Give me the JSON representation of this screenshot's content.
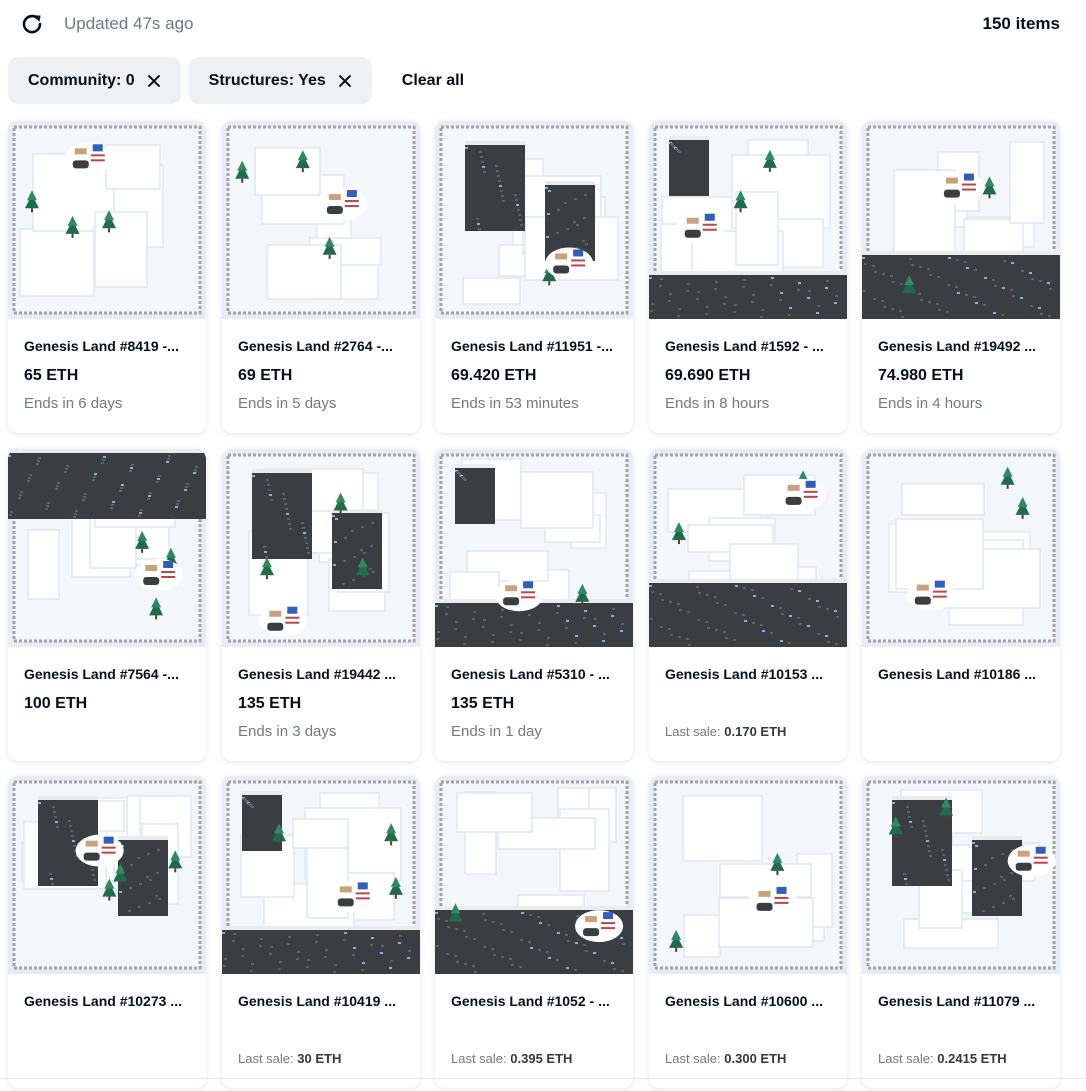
{
  "header": {
    "updated": "Updated 47s ago",
    "item_count": "150 items"
  },
  "filters": {
    "chips": [
      {
        "label": "Community: 0"
      },
      {
        "label": "Structures: Yes"
      }
    ],
    "clear_label": "Clear all"
  },
  "colors": {
    "snow": "#f3f6fb",
    "snow_shade": "#dfe7f2",
    "rock": "#3a3d42",
    "rock_light": "#5c6168",
    "ice": "#7fb3e0",
    "tree": "#1f6b4c",
    "fence": "#a8a2a0"
  },
  "cards": [
    {
      "title": "Genesis Land #8419 -...",
      "price": "65 ETH",
      "sub": "Ends in 6 days",
      "last_sale": ""
    },
    {
      "title": "Genesis Land #2764 -...",
      "price": "69 ETH",
      "sub": "Ends in 5 days",
      "last_sale": ""
    },
    {
      "title": "Genesis Land #11951 -...",
      "price": "69.420 ETH",
      "sub": "Ends in 53 minutes",
      "last_sale": ""
    },
    {
      "title": "Genesis Land #1592 - ...",
      "price": "69.690 ETH",
      "sub": "Ends in 8 hours",
      "last_sale": ""
    },
    {
      "title": "Genesis Land #19492 ...",
      "price": "74.980 ETH",
      "sub": "Ends in 4 hours",
      "last_sale": ""
    },
    {
      "title": "Genesis Land #7564 -...",
      "price": "100 ETH",
      "sub": "",
      "last_sale": ""
    },
    {
      "title": "Genesis Land #19442 ...",
      "price": "135 ETH",
      "sub": "Ends in 3 days",
      "last_sale": ""
    },
    {
      "title": "Genesis Land #5310 - ...",
      "price": "135 ETH",
      "sub": "Ends in 1 day",
      "last_sale": ""
    },
    {
      "title": "Genesis Land #10153 ...",
      "price": "",
      "sub": "",
      "last_sale": "0.170 ETH"
    },
    {
      "title": "Genesis Land #10186 ...",
      "price": "",
      "sub": "",
      "last_sale": ""
    },
    {
      "title": "Genesis Land #10273 ...",
      "price": "",
      "sub": "",
      "last_sale": ""
    },
    {
      "title": "Genesis Land #10419 ...",
      "price": "",
      "sub": "",
      "last_sale": "30 ETH"
    },
    {
      "title": "Genesis Land #1052 - ...",
      "price": "",
      "sub": "",
      "last_sale": "0.395 ETH"
    },
    {
      "title": "Genesis Land #10600 ...",
      "price": "",
      "sub": "",
      "last_sale": "0.300 ETH"
    },
    {
      "title": "Genesis Land #11079 ...",
      "price": "",
      "sub": "",
      "last_sale": "0.2415 ETH"
    }
  ],
  "last_sale_prefix": "Last sale:"
}
